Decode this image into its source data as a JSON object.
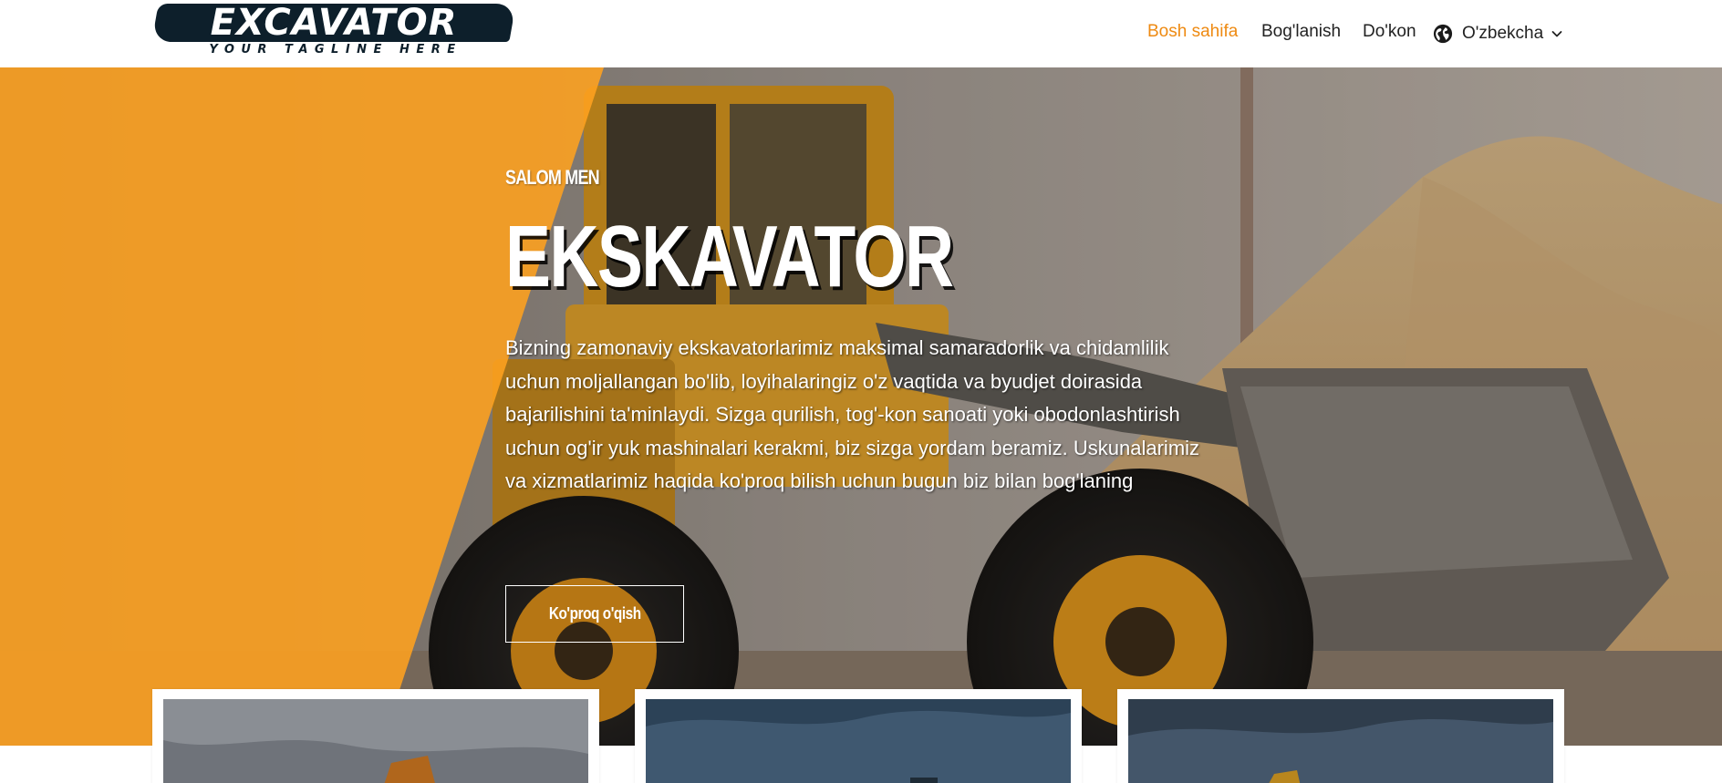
{
  "logo": {
    "word": "EXCAVATOR",
    "tagline": "YOUR TAGLINE HERE"
  },
  "nav": {
    "items": [
      {
        "label": "Bosh sahifa",
        "active": true
      },
      {
        "label": "Bog'lanish",
        "active": false
      },
      {
        "label": "Do'kon",
        "active": false
      }
    ],
    "language": {
      "label": "O'zbekcha",
      "icon": "globe-icon"
    }
  },
  "hero": {
    "eyebrow": "SALOM MEN",
    "title": "EKSKAVATOR",
    "text": "Bizning zamonaviy ekskavatorlarimiz maksimal samaradorlik va chidamlilik uchun moljallangan bo'lib, loyihalaringiz o'z vaqtida va byudjet doirasida bajarilishini ta'minlaydi. Sizga qurilish, tog'-kon sanoati yoki obodonlashtirish uchun og'ir yuk mashinalari kerakmi, biz sizga yordam beramiz. Uskunalarimiz va xizmatlarimiz haqida ko'proq bilish uchun bugun biz bilan bog'laning",
    "button_label": "Ko'proq o'qish"
  },
  "colors": {
    "accent": "#ee8a12",
    "hero_overlay": "#ffa21f",
    "logo_dark": "#0d1f2b"
  },
  "cards": [
    {
      "image": "excavator-photo-1"
    },
    {
      "image": "excavator-photo-2"
    },
    {
      "image": "excavator-photo-3"
    }
  ]
}
